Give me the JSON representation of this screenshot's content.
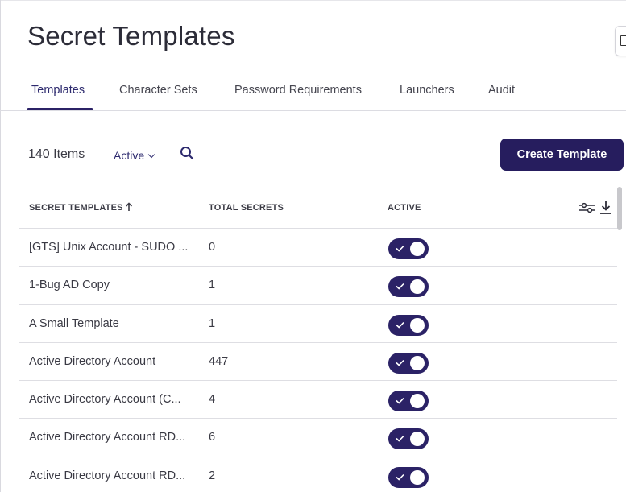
{
  "page": {
    "title": "Secret Templates"
  },
  "tabs": [
    {
      "label": "Templates",
      "active": true
    },
    {
      "label": "Character Sets",
      "active": false
    },
    {
      "label": "Password Requirements",
      "active": false
    },
    {
      "label": "Launchers",
      "active": false
    },
    {
      "label": "Audit",
      "active": false
    }
  ],
  "toolbar": {
    "items_count": "140 Items",
    "filter_label": "Active",
    "search_icon": "search-icon",
    "create_label": "Create Template"
  },
  "table": {
    "columns": [
      "SECRET TEMPLATES",
      "TOTAL SECRETS",
      "ACTIVE"
    ],
    "sort": {
      "column": "SECRET TEMPLATES",
      "direction": "ascending"
    },
    "rows": [
      {
        "name": "[GTS] Unix Account - SUDO ...",
        "total": "0",
        "active": true
      },
      {
        "name": "1-Bug AD Copy",
        "total": "1",
        "active": true
      },
      {
        "name": "A Small Template",
        "total": "1",
        "active": true
      },
      {
        "name": "Active Directory Account",
        "total": "447",
        "active": true
      },
      {
        "name": "Active Directory Account (C...",
        "total": "4",
        "active": true
      },
      {
        "name": "Active Directory Account RD...",
        "total": "6",
        "active": true
      },
      {
        "name": "Active Directory Account RD...",
        "total": "2",
        "active": true
      }
    ]
  },
  "colors": {
    "accent": "#261d5e",
    "toggle_on": "#2b2266",
    "divider": "#dedee3"
  }
}
